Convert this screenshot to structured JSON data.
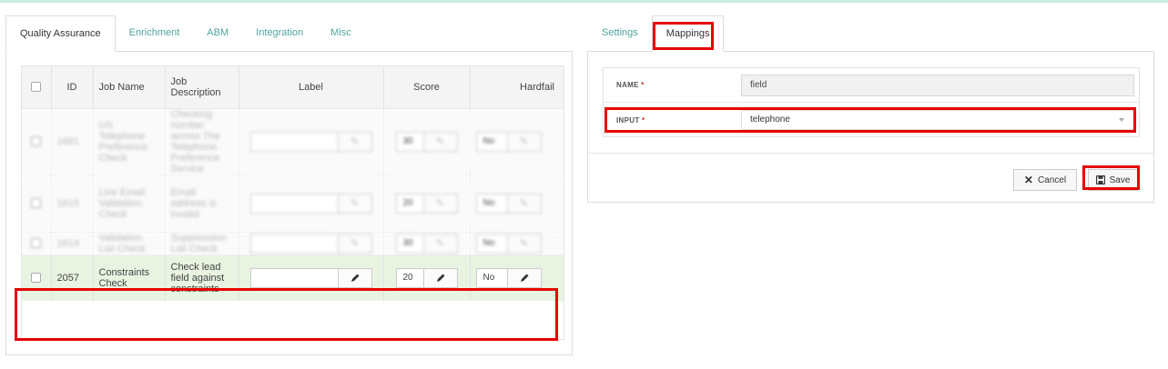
{
  "left_tabs": [
    "Quality Assurance",
    "Enrichment",
    "ABM",
    "Integration",
    "Misc"
  ],
  "right_tabs": [
    "Settings",
    "Mappings"
  ],
  "table": {
    "headers": {
      "id": "ID",
      "job_name": "Job Name",
      "job_description": "Job Description",
      "label": "Label",
      "score": "Score",
      "hardfail": "Hardfail"
    },
    "blurred_rows": [
      {
        "id": "1681",
        "name": "US Telephone Preference Check",
        "desc": "Checking number across The Telephone Preference Service",
        "score": "30",
        "hard": "No"
      },
      {
        "id": "1615",
        "name": "Live Email Validation Check",
        "desc": "Email address is invalid",
        "score": "20",
        "hard": "No"
      },
      {
        "id": "1614",
        "name": "Validation List Check",
        "desc": "Suppression List Check",
        "score": "30",
        "hard": "No"
      }
    ],
    "selected_row": {
      "id": "2057",
      "job_name": "Constraints Check",
      "job_description": "Check lead field against constraints",
      "label": "",
      "score": "20",
      "hardfail": "No"
    }
  },
  "form": {
    "name_label": "NAME",
    "name_value": "field",
    "input_label": "INPUT",
    "input_value": "telephone",
    "required_mark": "*"
  },
  "actions": {
    "cancel": "Cancel",
    "save": "Save"
  },
  "colors": {
    "accent": "#4fa59a",
    "highlight_row": "#e8f3e1",
    "annotation": "#e60000"
  }
}
